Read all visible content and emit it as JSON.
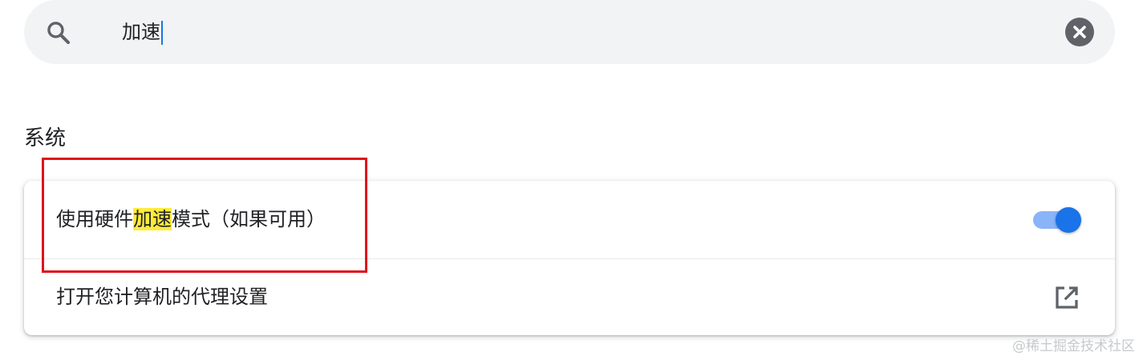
{
  "search": {
    "query": "加速",
    "icon": "search-icon",
    "clear_icon": "clear-icon"
  },
  "section": {
    "title": "系统"
  },
  "settings": {
    "hardware_accel": {
      "label_before": "使用硬件",
      "label_highlight": "加速",
      "label_after": "模式（如果可用）",
      "enabled": true
    },
    "proxy": {
      "label": "打开您计算机的代理设置",
      "icon": "open-external-icon"
    }
  },
  "watermark": "@稀土掘金技术社区",
  "colors": {
    "accent": "#1a73e8",
    "toggle_track": "#8ab4f8",
    "search_highlight": "#ffeb3b",
    "annotation_box": "#e0101c"
  }
}
